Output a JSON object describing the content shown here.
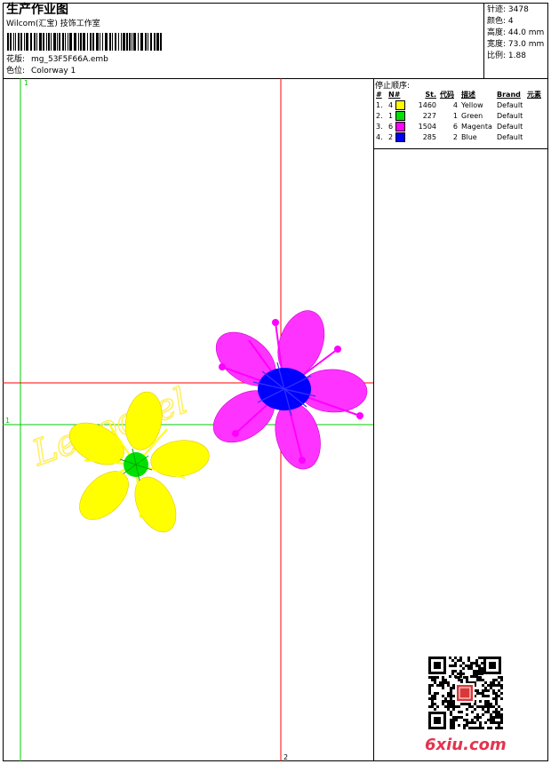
{
  "header": {
    "title": "生产作业图",
    "subtitle": "Wilcom(汇宝) 技饰工作室",
    "design_label": "花版:",
    "design_value": "mg_53F5F66A.emb",
    "colorway_label": "色位:",
    "colorway_value": "Colorway 1"
  },
  "stats": {
    "stitches": "针迹: 3478",
    "colors": "颜色: 4",
    "height": "高度: 44.0 mm",
    "width": "宽度: 73.0 mm",
    "scale": "比例: 1.88"
  },
  "stops": {
    "title": "停止顺序:",
    "columns": [
      "#",
      "N#",
      "St.",
      "代码",
      "描述",
      "Brand",
      "元素"
    ],
    "rows": [
      {
        "idx": "1.",
        "n": "4",
        "stitches": "1460",
        "code": "4",
        "desc": "Yellow",
        "brand": "Default",
        "color": "#ffff00"
      },
      {
        "idx": "2.",
        "n": "1",
        "stitches": "227",
        "code": "1",
        "desc": "Green",
        "brand": "Default",
        "color": "#00e000"
      },
      {
        "idx": "3.",
        "n": "6",
        "stitches": "1504",
        "code": "6",
        "desc": "Magenta",
        "brand": "Default",
        "color": "#ff00ff"
      },
      {
        "idx": "4.",
        "n": "2",
        "stitches": "285",
        "code": "2",
        "desc": "Blue",
        "brand": "Default",
        "color": "#0000ff"
      }
    ]
  },
  "guides": {
    "green_top": "1",
    "green_left": "1",
    "red_bottom": "2"
  },
  "design": {
    "script_text": "Leooovel",
    "colors": {
      "yellow": "#ffff00",
      "green": "#00e000",
      "magenta": "#ff00ff",
      "blue": "#0000ff",
      "red_guide": "#ff0000",
      "green_guide": "#00cc00"
    }
  },
  "watermark": "6xiu.com"
}
